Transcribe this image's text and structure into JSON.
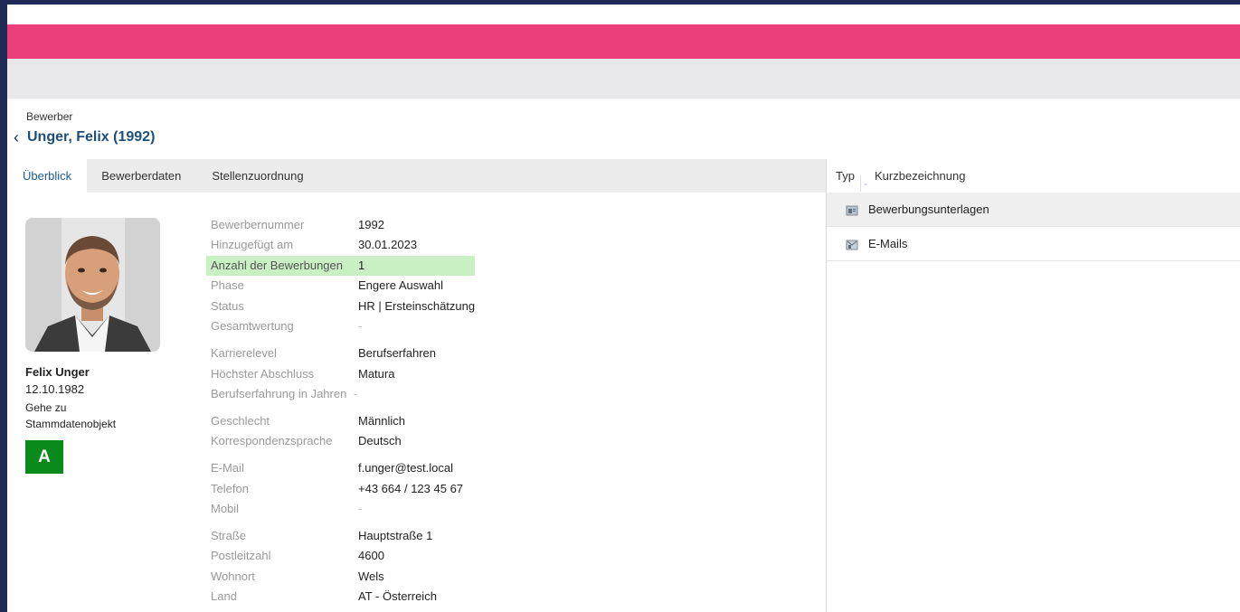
{
  "breadcrumb": "Bewerber",
  "record_title": "Unger, Felix (1992)",
  "tabs": [
    {
      "label": "Überblick"
    },
    {
      "label": "Bewerberdaten"
    },
    {
      "label": "Stellenzuordnung"
    }
  ],
  "person": {
    "name": "Felix Unger",
    "birthdate": "12.10.1982",
    "goto_link": "Gehe zu Stammdatenobjekt",
    "badge": "A",
    "badge_color": "#0b8a1c"
  },
  "details": [
    {
      "label": "Bewerbernummer",
      "value": "1992"
    },
    {
      "label": "Hinzugefügt am",
      "value": "30.01.2023"
    },
    {
      "label": "Anzahl der Bewerbungen",
      "value": "1",
      "highlight": true
    },
    {
      "label": "Phase",
      "value": "Engere Auswahl"
    },
    {
      "label": "Status",
      "value": "HR | Ersteinschätzung"
    },
    {
      "label": "Gesamtwertung",
      "value": "-"
    },
    {
      "label": "Karrierelevel",
      "value": "Berufserfahren"
    },
    {
      "label": "Höchster Abschluss",
      "value": "Matura"
    },
    {
      "label": "Berufserfahrung in Jahren",
      "value": "-"
    },
    {
      "label": "Geschlecht",
      "value": "Männlich"
    },
    {
      "label": "Korrespondenzsprache",
      "value": "Deutsch"
    },
    {
      "label": "E-Mail",
      "value": "f.unger@test.local"
    },
    {
      "label": "Telefon",
      "value": "+43 664 / 123 45 67"
    },
    {
      "label": "Mobil",
      "value": "-"
    },
    {
      "label": "Straße",
      "value": "Hauptstraße 1"
    },
    {
      "label": "Postleitzahl",
      "value": "4600"
    },
    {
      "label": "Wohnort",
      "value": "Wels"
    },
    {
      "label": "Land",
      "value": "AT - Österreich"
    }
  ],
  "right_panel": {
    "columns": [
      "Typ",
      "Kurzbezeichnung"
    ],
    "items": [
      {
        "icon": "document-folder-icon",
        "label": "Bewerbungsunterlagen"
      },
      {
        "icon": "mail-folder-icon",
        "label": "E-Mails"
      }
    ]
  },
  "colors": {
    "accent_bar": "#ea3f7a",
    "highlight_row": "#c9f0c3",
    "title_blue": "#1d4f7c"
  }
}
